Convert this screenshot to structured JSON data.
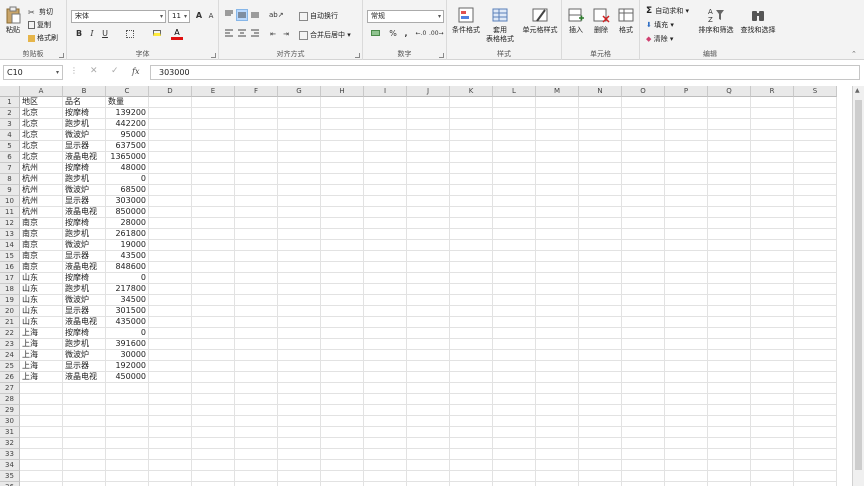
{
  "ribbon": {
    "clipboard": {
      "label": "剪贴板",
      "paste": "粘贴",
      "cut": "剪切",
      "copy": "复制",
      "format_painter": "格式刷"
    },
    "font": {
      "label": "字体",
      "font_name": "宋体",
      "font_size": "11",
      "bold": "B",
      "italic": "I",
      "underline": "U",
      "grow": "A",
      "shrink": "A",
      "font_color": "A"
    },
    "alignment": {
      "label": "对齐方式",
      "wrap": "自动换行",
      "merge": "合并后居中"
    },
    "number": {
      "label": "数字",
      "format": "常规",
      "percent": "%",
      "comma": ","
    },
    "styles": {
      "label": "样式",
      "conditional": "条件格式",
      "table_top": "套用",
      "table_bottom": "表格格式",
      "cell_styles": "单元格样式"
    },
    "cells": {
      "label": "单元格",
      "insert": "插入",
      "delete": "删除",
      "format": "格式"
    },
    "editing": {
      "label": "编辑",
      "autosum": "自动求和",
      "fill": "填充",
      "clear": "清除",
      "sort": "排序和筛选",
      "find": "查找和选择"
    }
  },
  "formula_bar": {
    "name_box": "C10",
    "fx": "fx",
    "value": "303000"
  },
  "columns": [
    "A",
    "B",
    "C",
    "D",
    "E",
    "F",
    "G",
    "H",
    "I",
    "J",
    "K",
    "L",
    "M",
    "N",
    "O",
    "P",
    "Q",
    "R",
    "S"
  ],
  "row_numbers": [
    "1",
    "2",
    "3",
    "4",
    "5",
    "6",
    "7",
    "8",
    "9",
    "10",
    "11",
    "12",
    "13",
    "14",
    "15",
    "16",
    "17",
    "18",
    "19",
    "20",
    "21",
    "22",
    "23",
    "24",
    "25",
    "26",
    "27",
    "28",
    "29",
    "30",
    "31",
    "32",
    "33",
    "34",
    "35",
    "36"
  ],
  "header": [
    "地区",
    "品名",
    "数量"
  ],
  "rows": [
    [
      "北京",
      "按摩椅",
      "139200"
    ],
    [
      "北京",
      "跑步机",
      "442200"
    ],
    [
      "北京",
      "微波炉",
      "95000"
    ],
    [
      "北京",
      "显示器",
      "637500"
    ],
    [
      "北京",
      "液晶电视",
      "1365000"
    ],
    [
      "杭州",
      "按摩椅",
      "48000"
    ],
    [
      "杭州",
      "跑步机",
      "0"
    ],
    [
      "杭州",
      "微波炉",
      "68500"
    ],
    [
      "杭州",
      "显示器",
      "303000"
    ],
    [
      "杭州",
      "液晶电视",
      "850000"
    ],
    [
      "南京",
      "按摩椅",
      "28000"
    ],
    [
      "南京",
      "跑步机",
      "261800"
    ],
    [
      "南京",
      "微波炉",
      "19000"
    ],
    [
      "南京",
      "显示器",
      "43500"
    ],
    [
      "南京",
      "液晶电视",
      "848600"
    ],
    [
      "山东",
      "按摩椅",
      "0"
    ],
    [
      "山东",
      "跑步机",
      "217800"
    ],
    [
      "山东",
      "微波炉",
      "34500"
    ],
    [
      "山东",
      "显示器",
      "301500"
    ],
    [
      "山东",
      "液晶电视",
      "435000"
    ],
    [
      "上海",
      "按摩椅",
      "0"
    ],
    [
      "上海",
      "跑步机",
      "391600"
    ],
    [
      "上海",
      "微波炉",
      "30000"
    ],
    [
      "上海",
      "显示器",
      "192000"
    ],
    [
      "上海",
      "液晶电视",
      "450000"
    ]
  ]
}
